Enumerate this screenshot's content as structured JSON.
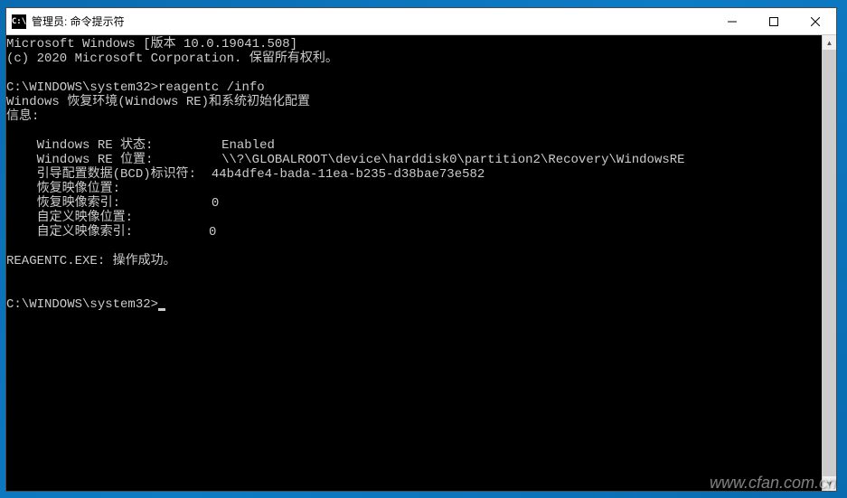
{
  "titlebar": {
    "icon_label": "C:\\",
    "title": "管理员: 命令提示符"
  },
  "terminal": {
    "line_version": "Microsoft Windows [版本 10.0.19041.508]",
    "line_copyright": "(c) 2020 Microsoft Corporation. 保留所有权利。",
    "prompt1": "C:\\WINDOWS\\system32>reagentc /info",
    "line_winre_header": "Windows 恢复环境(Windows RE)和系统初始化配置",
    "line_info": "信息:",
    "field_re_status_label": "Windows RE 状态:",
    "field_re_status_value": "Enabled",
    "field_re_location_label": "Windows RE 位置:",
    "field_re_location_value": "\\\\?\\GLOBALROOT\\device\\harddisk0\\partition2\\Recovery\\WindowsRE",
    "field_bcd_label": "引导配置数据(BCD)标识符:",
    "field_bcd_value": "44b4dfe4-bada-11ea-b235-d38bae73e582",
    "field_recovery_image_loc_label": "恢复映像位置:",
    "field_recovery_image_loc_value": "",
    "field_recovery_image_idx_label": "恢复映像索引:",
    "field_recovery_image_idx_value": "0",
    "field_custom_image_loc_label": "自定义映像位置:",
    "field_custom_image_loc_value": "",
    "field_custom_image_idx_label": "自定义映像索引:",
    "field_custom_image_idx_value": "0",
    "line_success": "REAGENTC.EXE: 操作成功。",
    "prompt2": "C:\\WINDOWS\\system32>"
  },
  "watermark": "www.cfan.com.cn"
}
